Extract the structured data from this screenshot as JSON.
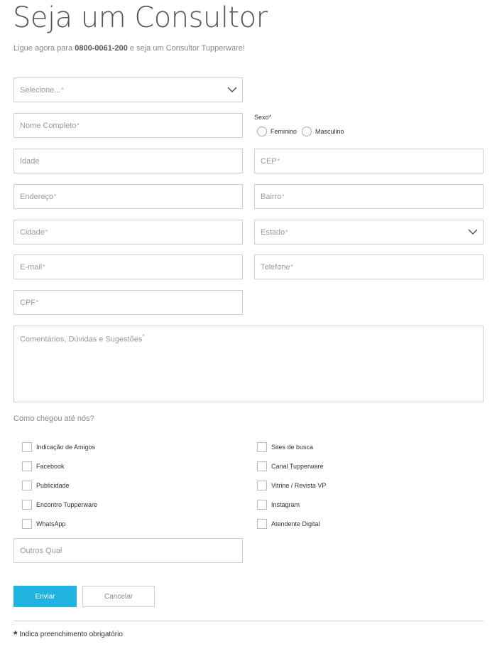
{
  "header": {
    "title": "Seja um Consultor",
    "subtitle_prefix": "Ligue agora para ",
    "phone": "0800-0061-200",
    "subtitle_suffix": " e seja um Consultor Tupperware!"
  },
  "form": {
    "select_type": {
      "label": "Selecione...",
      "required": "*"
    },
    "nome": {
      "label": "Nome Completo",
      "required": "*"
    },
    "sexo": {
      "label": "Sexo",
      "required": "*",
      "options": [
        "Feminino",
        "Masculino"
      ]
    },
    "idade": {
      "label": "Idade"
    },
    "cep": {
      "label": "CEP",
      "required": "*"
    },
    "endereco": {
      "label": "Endereço",
      "required": "*"
    },
    "bairro": {
      "label": "Bairro",
      "required": "*"
    },
    "cidade": {
      "label": "Cidade",
      "required": "*"
    },
    "estado": {
      "label": "Estado ",
      "required": "*"
    },
    "email": {
      "label": "E-mail",
      "required": "*"
    },
    "telefone": {
      "label": "Telefone",
      "required": "*"
    },
    "cpf": {
      "label": "CPF",
      "required": "*"
    },
    "comentarios": {
      "label": "Comentários, Dúvidas e Sugestões",
      "required": "*"
    }
  },
  "como_chegou": {
    "label": "Como chegou até nós?",
    "left": [
      "Indicação de Amigos",
      "Facebook",
      "Publicidade",
      "Encontro Tupperware",
      "WhatsApp"
    ],
    "right": [
      "Sites de busca",
      "Canal Tupperware",
      "Vitrine / Revista VP",
      "Instagram",
      "Atendente Digital"
    ],
    "outros_placeholder": "Outros Qual"
  },
  "buttons": {
    "submit": "Enviar",
    "cancel": "Cancelar"
  },
  "footnote": {
    "asterisk": "*",
    "text": " Indica preenchimento obrigatório"
  },
  "colors": {
    "accent": "#1fb3e0",
    "border": "#cfcfcf",
    "text": "#888888"
  },
  "icons": {
    "dropdown": "chevron-down-icon"
  }
}
